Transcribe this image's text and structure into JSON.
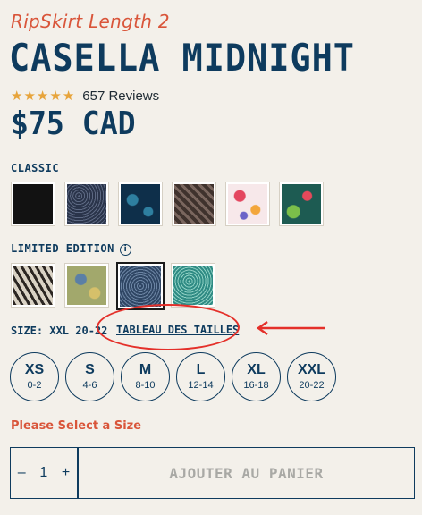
{
  "product": {
    "subtitle": "RipSkirt Length 2",
    "title": "CASELLA MIDNIGHT",
    "rating": {
      "stars": 5,
      "reviews_text": "657 Reviews"
    },
    "price": "$75 CAD"
  },
  "colors": {
    "classic_label": "CLASSIC",
    "limited_label": "LIMITED EDITION",
    "info_glyph": "i",
    "classic": [
      {
        "name": "black-swatch",
        "fill": "#121212"
      },
      {
        "name": "navy-dot-swatch",
        "fill": "#2f3b52"
      },
      {
        "name": "navy-leaf-swatch",
        "fill": "#10344f"
      },
      {
        "name": "brown-leaf-swatch",
        "fill": "#5a4943"
      },
      {
        "name": "pink-floral-swatch",
        "fill": "#e9909f"
      },
      {
        "name": "teal-tropical-swatch",
        "fill": "#1f6a5a"
      }
    ],
    "limited": [
      {
        "name": "animal-print-swatch",
        "fill": "#8a8175"
      },
      {
        "name": "olive-floral-swatch",
        "fill": "#9ea76a"
      },
      {
        "name": "midnight-swatch",
        "fill": "#3c5574"
      },
      {
        "name": "aqua-print-swatch",
        "fill": "#4aa59c"
      }
    ]
  },
  "size": {
    "label": "SIZE: XXL 20-22",
    "chart_link": "TABLEAU DES TAILLES",
    "options": [
      {
        "size": "XS",
        "range": "0-2"
      },
      {
        "size": "S",
        "range": "4-6"
      },
      {
        "size": "M",
        "range": "8-10"
      },
      {
        "size": "L",
        "range": "12-14"
      },
      {
        "size": "XL",
        "range": "16-18"
      },
      {
        "size": "XXL",
        "range": "20-22"
      }
    ]
  },
  "warning": "Please Select a Size",
  "quantity": {
    "minus": "–",
    "value": "1",
    "plus": "+"
  },
  "cart_button": "AJOUTER AU PANIER",
  "palette": {
    "brand": "#0e3b5e",
    "accent": "#d9553a",
    "highlight": "#e4302a"
  }
}
